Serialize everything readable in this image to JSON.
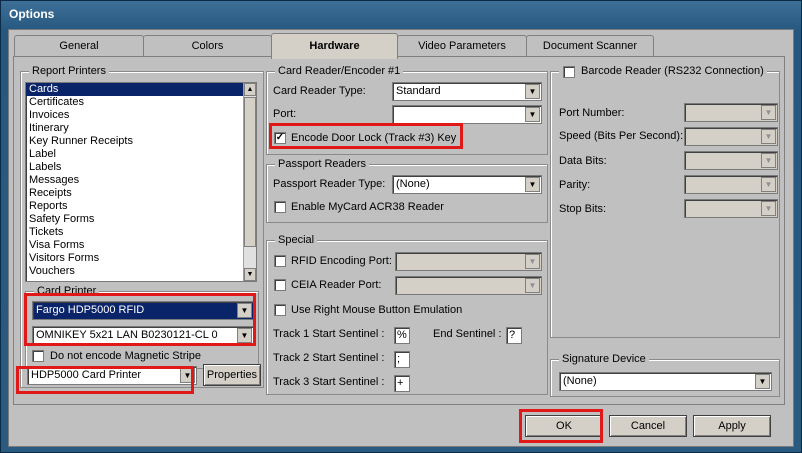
{
  "window": {
    "title": "Options"
  },
  "tabs": [
    {
      "label": "General"
    },
    {
      "label": "Colors"
    },
    {
      "label": "Hardware"
    },
    {
      "label": "Video Parameters"
    },
    {
      "label": "Document Scanner"
    }
  ],
  "report_printers": {
    "label": "Report Printers",
    "items": [
      "Cards",
      "Certificates",
      "Invoices",
      "Itinerary",
      "Key Runner Receipts",
      "Label",
      "Labels",
      "Messages",
      "Receipts",
      "Reports",
      "Safety Forms",
      "Tickets",
      "Visa Forms",
      "Visitors Forms",
      "Vouchers"
    ],
    "selected": "Cards"
  },
  "card_printer": {
    "label": "Card Printer",
    "printer_value": "Fargo HDP5000 RFID",
    "encoder_value": "OMNIKEY 5x21 LAN B0230121-CL 0",
    "no_encode_label": "Do not encode Magnetic Stripe",
    "no_encode_checked": false
  },
  "report_printer_select": {
    "value": "HDP5000 Card Printer",
    "properties_label": "Properties"
  },
  "card_reader": {
    "label": "Card Reader/Encoder #1",
    "type_label": "Card Reader Type:",
    "type_value": "Standard",
    "port_label": "Port:",
    "port_value": "",
    "encode_door_label": "Encode Door Lock (Track #3) Key",
    "encode_door_checked": true
  },
  "passport": {
    "label": "Passport Readers",
    "type_label": "Passport Reader Type:",
    "type_value": "(None)",
    "mycard_label": "Enable MyCard ACR38 Reader",
    "mycard_checked": false
  },
  "special": {
    "label": "Special",
    "rfid_label": "RFID Encoding Port:",
    "ceia_label": "CEIA Reader Port:",
    "right_mouse_label": "Use Right Mouse Button Emulation",
    "track1_label": "Track 1 Start Sentinel :",
    "track1_value": "%",
    "end_label": "End Sentinel :",
    "end_value": "?",
    "track2_label": "Track 2 Start Sentinel :",
    "track2_value": ";",
    "track3_label": "Track 3 Start Sentinel :",
    "track3_value": "+"
  },
  "barcode": {
    "label": "Barcode Reader (RS232 Connection)",
    "checked": false,
    "port_label": "Port Number:",
    "speed_label": "Speed (Bits Per Second):",
    "data_label": "Data Bits:",
    "parity_label": "Parity:",
    "stop_label": "Stop Bits:"
  },
  "signature": {
    "label": "Signature Device",
    "value": "(None)"
  },
  "buttons": {
    "ok": "OK",
    "cancel": "Cancel",
    "apply": "Apply"
  },
  "colors": {
    "highlight": "#e01818",
    "selection": "#0a246a"
  }
}
